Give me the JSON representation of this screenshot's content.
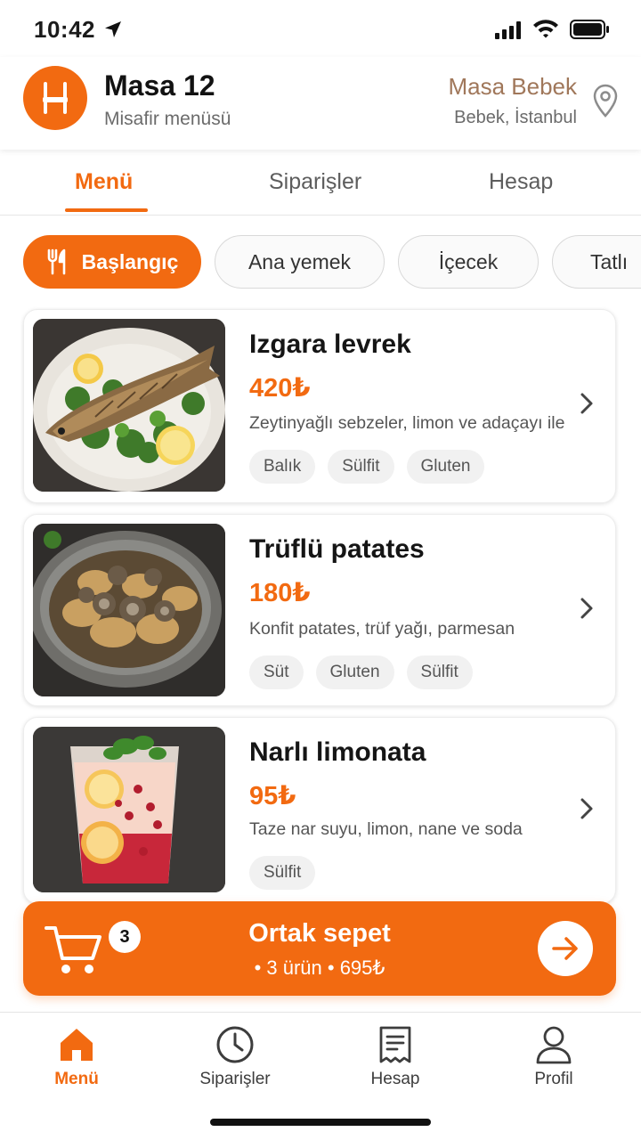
{
  "status_bar": {
    "time": "10:42"
  },
  "header": {
    "title": "Masa 12",
    "subtitle": "Misafir menüsü",
    "venue": "Masa Bebek",
    "area": "Bebek, İstanbul"
  },
  "tabs": [
    {
      "label": "Menü",
      "active": true
    },
    {
      "label": "Siparişler",
      "active": false
    },
    {
      "label": "Hesap",
      "active": false
    }
  ],
  "categories": [
    {
      "label": "Başlangıç",
      "active": true,
      "icon": "fork-knife-icon"
    },
    {
      "label": "Ana yemek",
      "active": false
    },
    {
      "label": "İçecek",
      "active": false
    },
    {
      "label": "Tatlı",
      "active": false
    }
  ],
  "items": [
    {
      "name": "Izgara levrek",
      "price": "420₺",
      "description": "Zeytinyağlı sebzeler, limon ve adaçayı ile",
      "tags": [
        "Balık",
        "Sülfit",
        "Gluten"
      ]
    },
    {
      "name": "Trüflü patates",
      "price": "180₺",
      "description": "Konfit patates, trüf yağı, parmesan",
      "tags": [
        "Süt",
        "Gluten",
        "Sülfit"
      ]
    },
    {
      "name": "Narlı limonata",
      "price": "95₺",
      "description": "Taze nar suyu, limon, nane ve soda",
      "tags": [
        "Sülfit"
      ]
    }
  ],
  "cart": {
    "count": "3",
    "title": "Ortak sepet",
    "summary": "• 3 ürün • 695₺"
  },
  "bottom_nav": [
    {
      "label": "Menü",
      "icon": "home-icon",
      "active": true
    },
    {
      "label": "Siparişler",
      "icon": "clock-icon",
      "active": false
    },
    {
      "label": "Hesap",
      "icon": "receipt-icon",
      "active": false
    },
    {
      "label": "Profil",
      "icon": "user-icon",
      "active": false
    }
  ],
  "colors": {
    "accent": "#f26a11",
    "venue_text": "#a0775a"
  }
}
